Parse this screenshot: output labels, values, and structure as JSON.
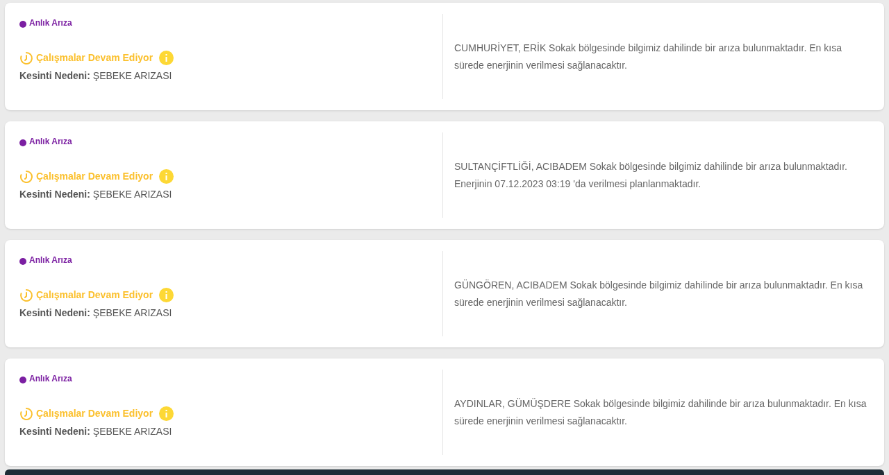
{
  "outages": [
    {
      "type": {
        "label": "Anlık Arıza",
        "color": "#7b1fa2"
      },
      "status": "Çalışmalar Devam Ediyor",
      "reason_label": "Kesinti Nedeni:",
      "reason": "ŞEBEKE ARIZASI",
      "description": "CUMHURİYET, ERİK Sokak bölgesinde bilgimiz dahilinde bir arıza bulunmaktadır. En kısa sürede enerjinin verilmesi sağlanacaktır."
    },
    {
      "type": {
        "label": "Anlık Arıza",
        "color": "#7b1fa2"
      },
      "status": "Çalışmalar Devam Ediyor",
      "reason_label": "Kesinti Nedeni:",
      "reason": "ŞEBEKE ARIZASI",
      "description": "SULTANÇİFTLİĞİ, ACIBADEM Sokak bölgesinde bilgimiz dahilinde bir arıza bulunmaktadır. Enerjinin 07.12.2023 03:19 'da verilmesi planlanmaktadır."
    },
    {
      "type": {
        "label": "Anlık Arıza",
        "color": "#7b1fa2"
      },
      "status": "Çalışmalar Devam Ediyor",
      "reason_label": "Kesinti Nedeni:",
      "reason": "ŞEBEKE ARIZASI",
      "description": "GÜNGÖREN, ACIBADEM Sokak bölgesinde bilgimiz dahilinde bir arıza bulunmaktadır. En kısa sürede enerjinin verilmesi sağlanacaktır."
    },
    {
      "type": {
        "label": "Anlık Arıza",
        "color": "#7b1fa2"
      },
      "status": "Çalışmalar Devam Ediyor",
      "reason_label": "Kesinti Nedeni:",
      "reason": "ŞEBEKE ARIZASI",
      "description": "AYDINLAR, GÜMÜŞDERE Sokak bölgesinde bilgimiz dahilinde bir arıza bulunmaktadır. En kısa sürede enerjinin verilmesi sağlanacaktır."
    }
  ]
}
